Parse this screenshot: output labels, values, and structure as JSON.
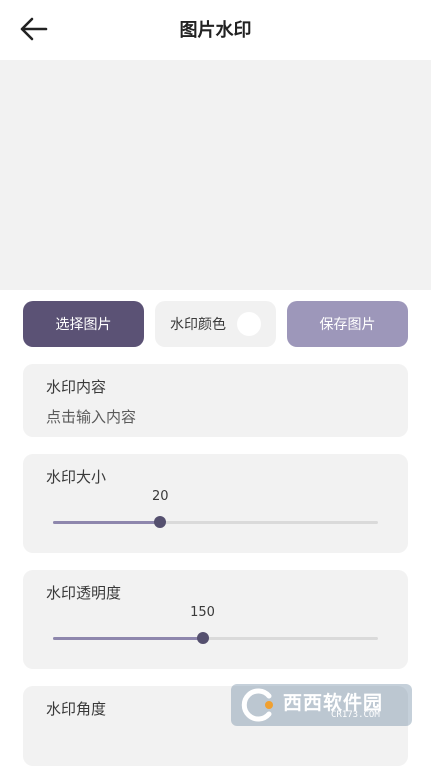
{
  "header": {
    "title": "图片水印",
    "back_icon": "arrow-left-icon"
  },
  "actions": {
    "select_label": "选择图片",
    "color_label": "水印颜色",
    "color_value": "#ffffff",
    "save_label": "保存图片"
  },
  "content": {
    "label": "水印内容",
    "placeholder": "点击输入内容"
  },
  "size": {
    "label": "水印大小",
    "value": "20",
    "fraction": 0.33
  },
  "opacity": {
    "label": "水印透明度",
    "value": "150",
    "fraction": 0.46
  },
  "angle": {
    "label": "水印角度"
  },
  "site_watermark": {
    "text": "西西软件园",
    "subtext": "CR173.COM"
  },
  "colors": {
    "primary": "#5b5275",
    "secondary": "#9d97ba",
    "card": "#f2f2f2"
  }
}
